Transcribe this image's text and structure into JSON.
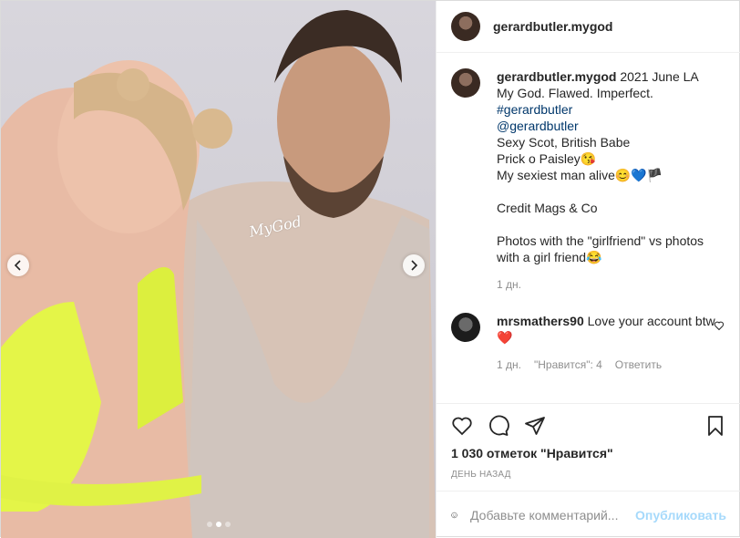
{
  "header": {
    "username": "gerardbutler.mygod"
  },
  "media": {
    "watermark": "MyGod",
    "slides": 3,
    "active_slide": 1
  },
  "caption": {
    "username": "gerardbutler.mygod",
    "first_line": "2021 June LA",
    "lines": [
      "My God. Flawed. Imperfect."
    ],
    "hashtag": "#gerardbutler",
    "mention": "@gerardbutler",
    "lines2": [
      "Sexy Scot, British Babe",
      "Prick o Paisley😘",
      "My sexiest man alive😊💙🏴"
    ],
    "credit": "Credit Mags & Co",
    "photos": "Photos with the \"girlfriend\" vs photos with a girl friend😂",
    "time": "1 дн."
  },
  "comment": {
    "username": "mrsmathers90",
    "text": "Love your account btw ❤️",
    "time": "1 дн.",
    "likes": "\"Нравится\": 4",
    "reply": "Ответить"
  },
  "likes": "1 030 отметок \"Нравится\"",
  "date": "ДЕНЬ НАЗАД",
  "add_comment": {
    "placeholder": "Добавьте комментарий...",
    "publish": "Опубликовать"
  }
}
